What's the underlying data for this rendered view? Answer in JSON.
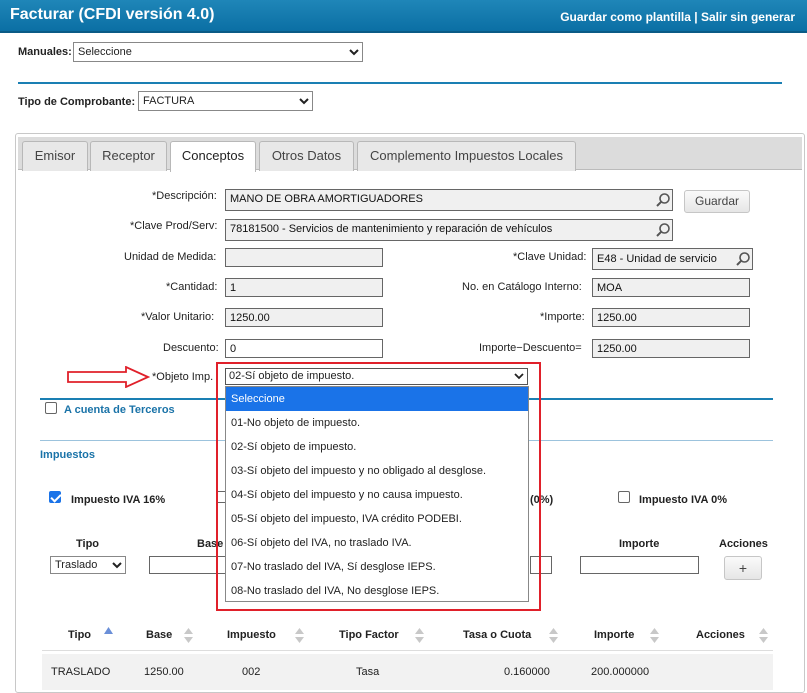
{
  "header": {
    "title": "Facturar (CFDI versión 4.0)",
    "save_template": "Guardar como plantilla",
    "separator": " | ",
    "exit": "Salir sin generar"
  },
  "manuales": {
    "label": "Manuales:",
    "value": "Seleccione"
  },
  "tipo_comprobante": {
    "label": "Tipo de Comprobante:",
    "value": "FACTURA"
  },
  "tabs": [
    {
      "label": "Emisor"
    },
    {
      "label": "Receptor"
    },
    {
      "label": "Conceptos",
      "active": true
    },
    {
      "label": "Otros Datos"
    },
    {
      "label": "Complemento Impuestos Locales"
    }
  ],
  "form": {
    "descripcion": {
      "label": "*Descripción:",
      "value": "MANO DE OBRA AMORTIGUADORES"
    },
    "guardar": "Guardar",
    "clave_prod": {
      "label": "*Clave Prod/Serv:",
      "value": "78181500 - Servicios de mantenimiento y reparación de vehículos"
    },
    "unidad_medida": {
      "label": "Unidad de Medida:",
      "value": ""
    },
    "clave_unidad": {
      "label": "*Clave Unidad:",
      "value": "E48 - Unidad de servicio"
    },
    "cantidad": {
      "label": "*Cantidad:",
      "value": "1"
    },
    "no_catalogo": {
      "label": "No. en Catálogo Interno:",
      "value": "MOA"
    },
    "valor_unitario": {
      "label": "*Valor Unitario:",
      "value": "1250.00"
    },
    "importe": {
      "label": "*Importe:",
      "value": "1250.00"
    },
    "descuento": {
      "label": "Descuento:",
      "value": "0"
    },
    "importe_descuento": {
      "label": "Importe−Descuento=",
      "value": "1250.00"
    },
    "objeto_imp": {
      "label": "*Objeto Imp.",
      "value": "02-Sí objeto de impuesto."
    }
  },
  "dropdown_options": [
    "Seleccione",
    "01-No objeto de impuesto.",
    "02-Sí objeto de impuesto.",
    "03-Sí objeto del impuesto y no obligado al desglose.",
    "04-Sí objeto del impuesto y no causa impuesto.",
    "05-Sí objeto del impuesto, IVA crédito PODEBI.",
    "06-Sí objeto del IVA, no traslado IVA.",
    "07-No traslado del IVA, Sí desglose IEPS.",
    "08-No traslado del IVA, No desglose IEPS."
  ],
  "terceros": {
    "label": "A cuenta de Terceros",
    "checked": false
  },
  "impuestos": {
    "title": "Impuestos",
    "iva16": {
      "label": "Impuesto IVA 16%",
      "checked": true
    },
    "partial_label": "(0%)",
    "iva0": {
      "label": "Impuesto IVA 0%",
      "checked": false
    },
    "tipo_label": "Tipo",
    "tipo_value": "Traslado",
    "base_label": "Base",
    "importe_label": "Importe",
    "acciones_label": "Acciones",
    "add_button": "+"
  },
  "table": {
    "headers": [
      "Tipo",
      "Base",
      "Impuesto",
      "Tipo Factor",
      "Tasa o Cuota",
      "Importe",
      "Acciones"
    ],
    "rows": [
      [
        "TRASLADO",
        "1250.00",
        "002",
        "Tasa",
        "0.160000",
        "200.000000",
        ""
      ]
    ]
  },
  "colors": {
    "header_blue": "#0b6fa4",
    "accent_red": "#e0202a",
    "selected_option": "#1a73e8"
  }
}
